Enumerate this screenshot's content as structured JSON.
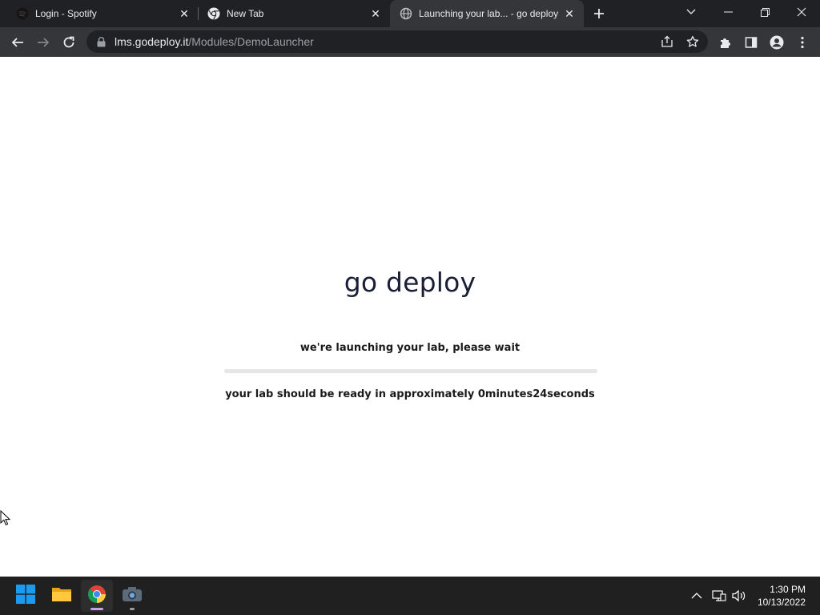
{
  "browser": {
    "tabs": [
      {
        "title": "Login - Spotify",
        "icon": "spotify-icon",
        "active": false
      },
      {
        "title": "New Tab",
        "icon": "chrome-icon",
        "active": false
      },
      {
        "title": "Launching your lab... - go deploy",
        "icon": "globe-icon",
        "active": true
      }
    ],
    "url_host": "lms.godeploy.it",
    "url_path": "/Modules/DemoLauncher"
  },
  "page": {
    "brand": "go deploy",
    "launch_message": "we're launching your lab, please wait",
    "progress": 0.0,
    "eta_message": "your lab should be ready in approximately 0minutes24seconds"
  },
  "taskbar": {
    "apps": [
      "start-icon",
      "file-explorer-icon",
      "chrome-icon",
      "camera-icon"
    ],
    "time": "1:30 PM",
    "date": "10/13/2022"
  },
  "colors": {
    "chrome_frame": "#202124",
    "chrome_toolbar": "#35363a",
    "brand_text": "#1a1f36",
    "taskbar": "#202020",
    "windows_blue": "#1a9bf0"
  }
}
